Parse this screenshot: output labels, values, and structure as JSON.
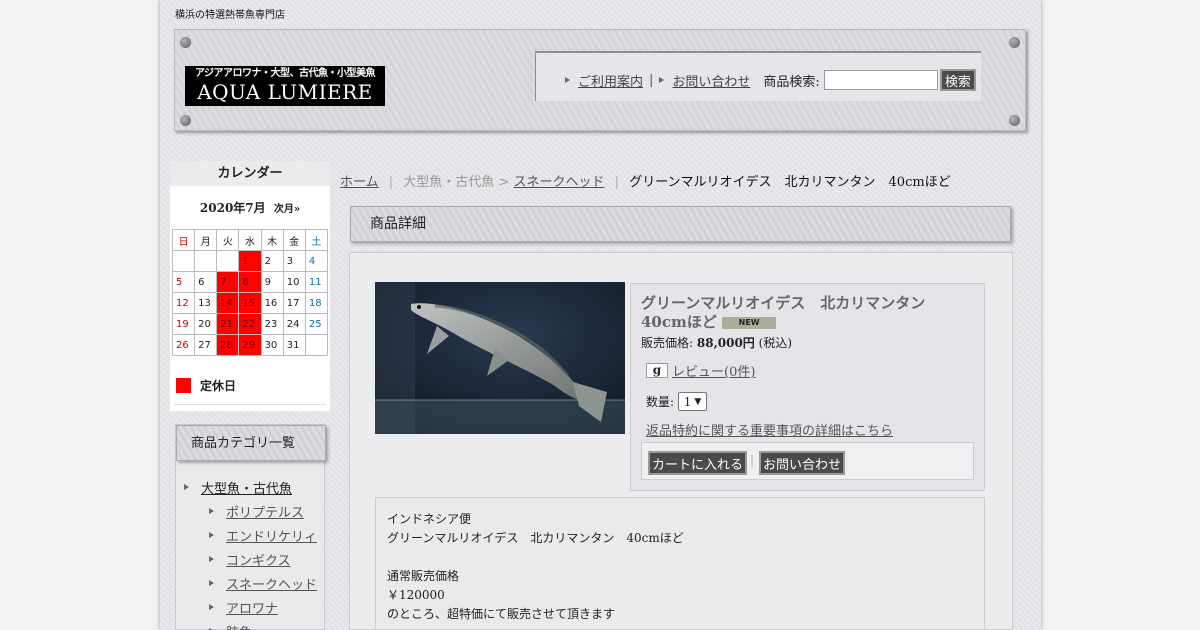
{
  "site": {
    "tagline": "横浜の特選熱帯魚専門店",
    "logo_line1": "アジアアロワナ・大型、古代魚・小型美魚",
    "logo_line2": "AQUA LUMIERE"
  },
  "header_nav": {
    "guide": "ご利用案内",
    "separator": "|",
    "contact": "お問い合わせ",
    "search_label": "商品検索:",
    "search_value": "",
    "search_button": "検索"
  },
  "calendar": {
    "title": "カレンダー",
    "month": "2020年7月",
    "next": "次月»",
    "weekdays": [
      "日",
      "月",
      "火",
      "水",
      "木",
      "金",
      "土"
    ],
    "weeks": [
      [
        "",
        "",
        "",
        "1",
        "2",
        "3",
        "4"
      ],
      [
        "5",
        "6",
        "7",
        "8",
        "9",
        "10",
        "11"
      ],
      [
        "12",
        "13",
        "14",
        "15",
        "16",
        "17",
        "18"
      ],
      [
        "19",
        "20",
        "21",
        "22",
        "23",
        "24",
        "25"
      ],
      [
        "26",
        "27",
        "28",
        "29",
        "30",
        "31",
        ""
      ]
    ],
    "holidays": [
      "1",
      "7",
      "8",
      "14",
      "15",
      "21",
      "22",
      "28",
      "29"
    ],
    "legend": "定休日"
  },
  "categories": {
    "title": "商品カテゴリ一覧",
    "parent": "大型魚・古代魚",
    "items": [
      "ポリプテルス",
      "エンドリケリィ",
      "コンギクス",
      "スネークヘッド",
      "アロワナ",
      "肺魚"
    ]
  },
  "breadcrumb": {
    "home": "ホーム",
    "sep": "|",
    "cat": "大型魚・古代魚",
    "arrow": ">",
    "sub": "スネークヘッド",
    "current": "グリーンマルリオイデス　北カリマンタン　40cmほど"
  },
  "detail": {
    "heading": "商品詳細",
    "name": "グリーンマルリオイデス　北カリマンタン　40cmほど",
    "new_badge": "NEW",
    "price_label": "販売価格:",
    "price": "88,000円",
    "tax": "(税込)",
    "review_icon": "g",
    "review": "レビュー(0件)",
    "qty_label": "数量:",
    "qty_value": "1",
    "return_link": "返品特約に関する重要事項の詳細はこちら",
    "cart_button": "カートに入れる",
    "inquiry_button": "お問い合わせ",
    "button_sep": "|",
    "description": [
      "インドネシア便",
      "グリーンマルリオイデス　北カリマンタン　40cmほど",
      "",
      "通常販売価格",
      "￥120000",
      "のところ、超特価にて販売させて頂きます"
    ]
  },
  "colors": {
    "holiday": "#ff0000",
    "button": "#4a4a4a"
  }
}
